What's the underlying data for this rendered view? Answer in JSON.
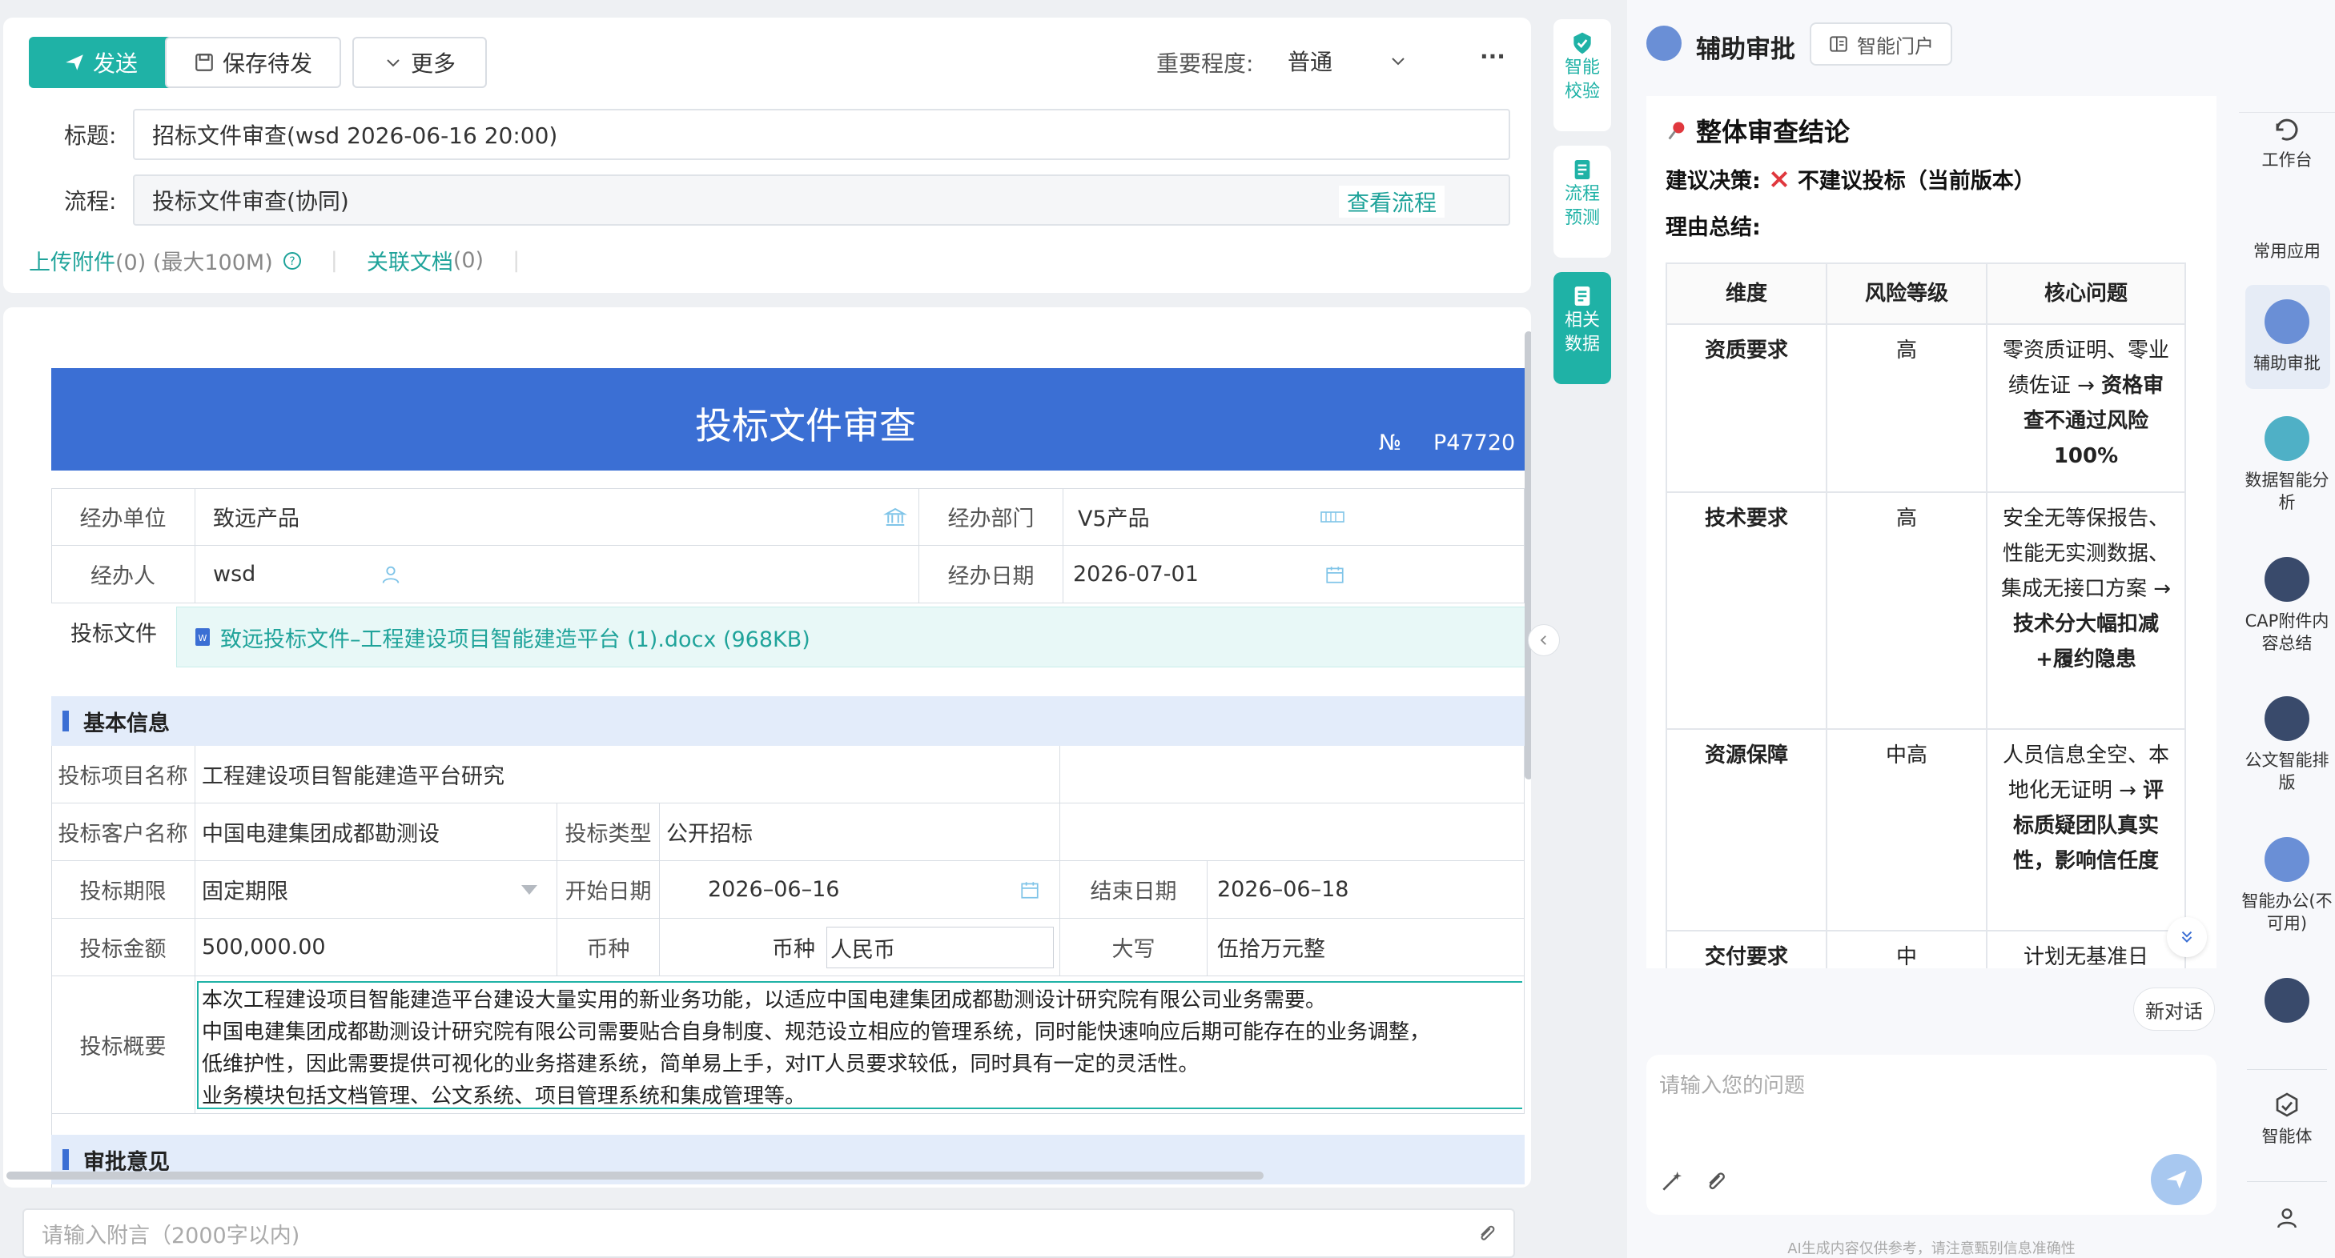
{
  "toolbar": {
    "send_label": "发送",
    "save_draft_label": "保存待发",
    "more_label": "更多",
    "importance_label": "重要程度:",
    "importance_value": "普通",
    "overflow": "···"
  },
  "form": {
    "title_label": "标题:",
    "title_value": "招标文件审查(wsd 2026-06-16 20:00)",
    "flow_label": "流程:",
    "flow_value": "投标文件审查(协同)",
    "view_flow": "查看流程",
    "upload_link": "上传附件",
    "upload_meta": "(0) (最大100M)",
    "related_link": "关联文档",
    "related_meta": "(0)"
  },
  "document": {
    "title": "投标文件审查",
    "no_label": "№",
    "no_value": "P47720",
    "org_label": "经办单位",
    "org_value": "致远产品",
    "dept_label": "经办部门",
    "dept_value": "V5产品",
    "handler_label": "经办人",
    "handler_value": "wsd",
    "date_label": "经办日期",
    "date_value": "2026-07-01",
    "file_label": "投标文件",
    "file_name": "致远投标文件–工程建设项目智能建造平台 (1).docx (968KB)",
    "section_basic": "基本信息",
    "project_label": "投标项目名称",
    "project_value": "工程建设项目智能建造平台研究",
    "client_label": "投标客户名称",
    "client_value": "中国电建集团成都勘测设",
    "type_label": "投标类型",
    "type_value": "公开招标",
    "period_label": "投标期限",
    "period_value": "固定期限",
    "start_label": "开始日期",
    "start_value": "2026–06–16",
    "end_label": "结束日期",
    "end_value": "2026–06–18",
    "amount_label": "投标金额",
    "amount_value": "500,000.00",
    "currency_label": "币种",
    "currency_label2": "币种",
    "currency_value": "人民币",
    "capital_label": "大写",
    "capital_value": "伍拾万元整",
    "summary_label": "投标概要",
    "summary_lines": [
      "本次工程建设项目智能建造平台建设大量实用的新业务功能，以适应中国电建集团成都勘测设计研究院有限公司业务需要。",
      "中国电建集团成都勘测设计研究院有限公司需要贴合自身制度、规范设立相应的管理系统，同时能快速响应后期可能存在的业务调整，",
      "低维护性，因此需要提供可视化的业务搭建系统，简单易上手，对IT人员要求较低，同时具有一定的灵活性。",
      "业务模块包括文档管理、公文系统、项目管理系统和集成管理等。"
    ],
    "section_approval": "审批意见"
  },
  "comment_placeholder": "请输入附言（2000字以内)",
  "side_tools": [
    {
      "label1": "智能",
      "label2": "校验"
    },
    {
      "label1": "流程",
      "label2": "预测"
    },
    {
      "label1": "相关",
      "label2": "数据"
    }
  ],
  "assistant": {
    "title": "辅助审批",
    "portal": "智能门户",
    "heading": "整体审查结论",
    "decision_label": "建议决策:",
    "decision_value": "不建议投标（当前版本）",
    "reason_label": "理由总结:",
    "table_headers": [
      "维度",
      "风险等级",
      "核心问题"
    ],
    "rows": [
      {
        "dim": "资质要求",
        "risk": "高",
        "issue_normal": "零资质证明、零业绩佐证 → ",
        "issue_bold": "资格审查不通过风险100%"
      },
      {
        "dim": "技术要求",
        "risk": "高",
        "issue_normal": "安全无等保报告、性能无实测数据、集成无接口方案 → ",
        "issue_bold": "技术分大幅扣减+履约隐患"
      },
      {
        "dim": "资源保障",
        "risk": "中高",
        "issue_normal": "人员信息全空、本地化无证明 → ",
        "issue_bold": "评标质疑团队真实性，影响信任度"
      },
      {
        "dim": "交付要求",
        "risk": "中",
        "issue_normal": "计划无基准日",
        "issue_bold": ""
      }
    ],
    "new_chat": "新对话",
    "input_placeholder": "请输入您的问题",
    "disclaimer": "AI生成内容仅供参考，请注意甄别信息准确性"
  },
  "rail": {
    "workbench": "工作台",
    "common_apps": "常用应用",
    "apps": [
      {
        "label": "辅助审批"
      },
      {
        "label": "数据智能分析"
      },
      {
        "label": "CAP附件内容总结"
      },
      {
        "label": "公文智能排版"
      },
      {
        "label": "智能办公(不可用)"
      }
    ],
    "agent": "智能体"
  }
}
